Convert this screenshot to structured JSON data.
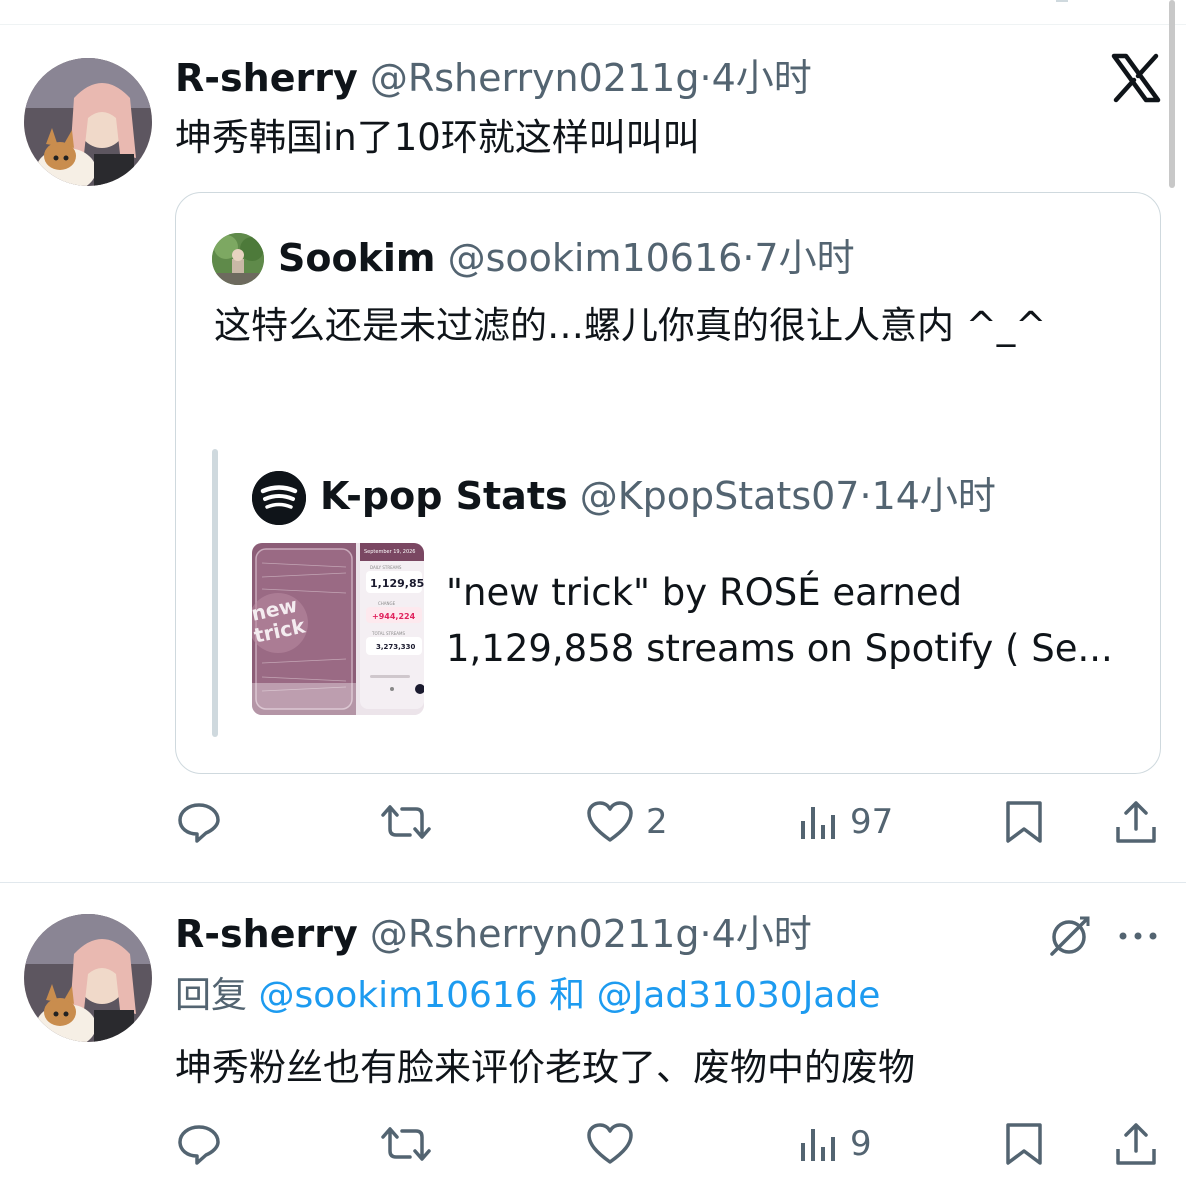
{
  "tweet1": {
    "name": "R-sherry",
    "handle": "@Rsherryn0211g",
    "time": "·4小时",
    "text": "坤秀韩国in了10环就这样叫叫叫",
    "quote": {
      "name": "Sookim",
      "handle": "@sookim10616",
      "time": "·7小时",
      "text": "这特么还是未过滤的…螺儿你真的很让人意内 ^_^",
      "nested": {
        "name": "K-pop Stats",
        "handle": "@KpopStats07",
        "time": "·14小时",
        "text_line1": "\"new trick\" by ROSÉ earned",
        "text_line2": "1,129,858 streams on Spotify ( Se...",
        "thumb": {
          "date": "September 19, 2026",
          "daily_label": "DAILY STREAMS",
          "daily_value": "1,129,85",
          "change_label": "CHANGE",
          "change_value": "+944,224",
          "total_label": "TOTAL STREAMS",
          "total_value": "3,273,330",
          "cover_text": "new trick"
        }
      }
    },
    "likes": "2",
    "views": "97"
  },
  "tweet2": {
    "name": "R-sherry",
    "handle": "@Rsherryn0211g",
    "time": "·4小时",
    "reply_prefix": "回复",
    "reply_mention1": "@sookim10616",
    "reply_and": "和",
    "reply_mention2": "@Jad31030Jade",
    "text": "坤秀粉丝也有脸来评价老玫了、废物中的废物",
    "views": "9"
  },
  "icons": {
    "x_logo": "x-logo-icon",
    "more": "more-icon",
    "grok": "grok-icon",
    "reply": "reply-icon",
    "retweet": "retweet-icon",
    "like": "heart-icon",
    "views": "views-icon",
    "bookmark": "bookmark-icon",
    "share": "share-icon"
  },
  "colors": {
    "text": "#0f1419",
    "secondary": "#536471",
    "link": "#1d9bf0",
    "border": "#cfd9de",
    "change_red": "#e0245e"
  }
}
